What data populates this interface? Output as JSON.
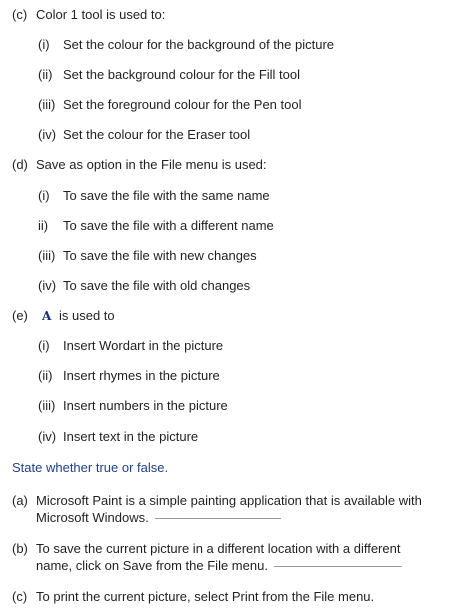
{
  "questions": {
    "c": {
      "num": "(c)",
      "text": "Color 1 tool is used to:",
      "options": [
        {
          "num": "(i)",
          "text": "Set the colour for the background of the picture"
        },
        {
          "num": "(ii)",
          "text": "Set the background colour for the Fill tool"
        },
        {
          "num": "(iii)",
          "text": "Set the foreground colour for the Pen tool"
        },
        {
          "num": "(iv)",
          "text": "Set the colour for the Eraser tool"
        }
      ]
    },
    "d": {
      "num": "(d)",
      "text": "Save as option in the File menu is used:",
      "options": [
        {
          "num": "(i)",
          "text": "To save the file with the same name"
        },
        {
          "num": "ii)",
          "text": "To save the file with a different name"
        },
        {
          "num": "(iii)",
          "text": "To save the file with new changes"
        },
        {
          "num": "(iv)",
          "text": "To save the file with old changes"
        }
      ]
    },
    "e": {
      "num": "(e)",
      "icon_glyph": "A",
      "icon": "text-tool-icon",
      "text": "is used to",
      "options": [
        {
          "num": "(i)",
          "text": "Insert Wordart in the picture"
        },
        {
          "num": "(ii)",
          "text": "Insert rhymes in the picture"
        },
        {
          "num": "(iii)",
          "text": "Insert numbers in the picture"
        },
        {
          "num": "(iv)",
          "text": "Insert text in the picture"
        }
      ]
    }
  },
  "true_false": {
    "heading": "State whether true or false.",
    "items": [
      {
        "num": "(a)",
        "line1": "Microsoft Paint is a simple painting application that is available with",
        "line2": "Microsoft Windows."
      },
      {
        "num": "(b)",
        "line1": "To save the current picture in a different location with a different",
        "line2": "name, click on Save from the File menu."
      },
      {
        "num": "(c)",
        "line1": "To print the current picture, select Print from the File menu."
      }
    ]
  },
  "colors": {
    "text": "#231f20",
    "heading": "#1f3f8f",
    "icon": "#1a2f7a"
  }
}
